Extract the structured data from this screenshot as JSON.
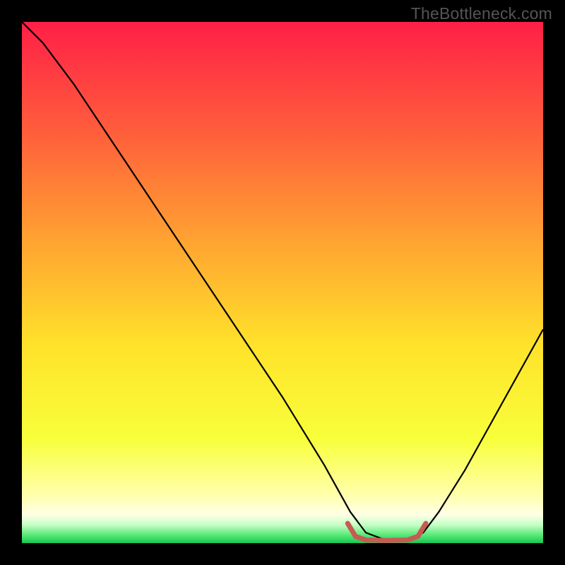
{
  "watermark": "TheBottleneck.com",
  "chart_data": {
    "type": "line",
    "title": "",
    "xlabel": "",
    "ylabel": "",
    "xlim": [
      0,
      100
    ],
    "ylim": [
      0,
      100
    ],
    "gradient_stops": [
      {
        "offset": 0.0,
        "color": "#ff1f47"
      },
      {
        "offset": 0.2,
        "color": "#ff5a3c"
      },
      {
        "offset": 0.42,
        "color": "#ffa331"
      },
      {
        "offset": 0.62,
        "color": "#ffe22a"
      },
      {
        "offset": 0.8,
        "color": "#f8ff3a"
      },
      {
        "offset": 0.905,
        "color": "#ffffa8"
      },
      {
        "offset": 0.945,
        "color": "#ffffe6"
      },
      {
        "offset": 0.965,
        "color": "#c4ffc4"
      },
      {
        "offset": 0.985,
        "color": "#55e876"
      },
      {
        "offset": 1.0,
        "color": "#18c552"
      }
    ],
    "series": [
      {
        "name": "bottleneck-curve",
        "color": "#000000",
        "width": 2.2,
        "x": [
          0,
          4,
          10,
          20,
          30,
          40,
          50,
          58,
          63,
          66,
          70,
          74,
          77,
          80,
          85,
          90,
          95,
          100
        ],
        "values": [
          100,
          96,
          88,
          73,
          58,
          43,
          28,
          15,
          6,
          2,
          0.5,
          0.5,
          2,
          6,
          14,
          23,
          32,
          41
        ]
      },
      {
        "name": "optimal-zone-marker",
        "color": "#c85a54",
        "width": 7,
        "x": [
          62.5,
          64,
          66,
          70,
          74,
          76,
          77.5
        ],
        "values": [
          3.8,
          1.3,
          0.6,
          0.5,
          0.6,
          1.3,
          3.8
        ]
      }
    ]
  }
}
